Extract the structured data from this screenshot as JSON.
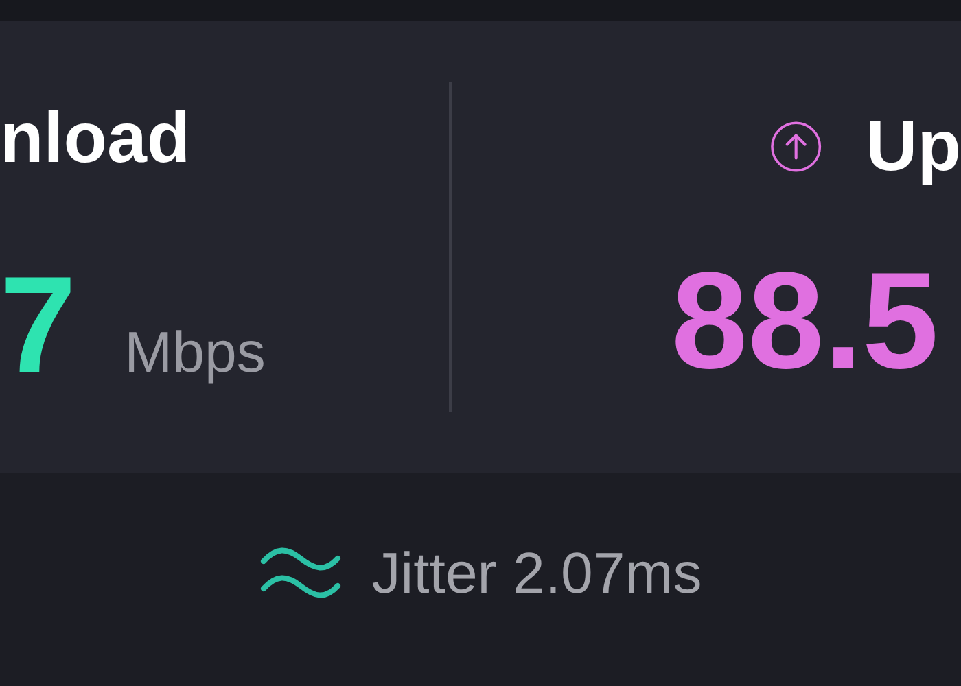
{
  "download": {
    "label": "nload",
    "value": "7",
    "unit": "Mbps"
  },
  "upload": {
    "label": "Up",
    "value": "88.5"
  },
  "jitter": {
    "text": "Jitter 2.07ms"
  }
}
